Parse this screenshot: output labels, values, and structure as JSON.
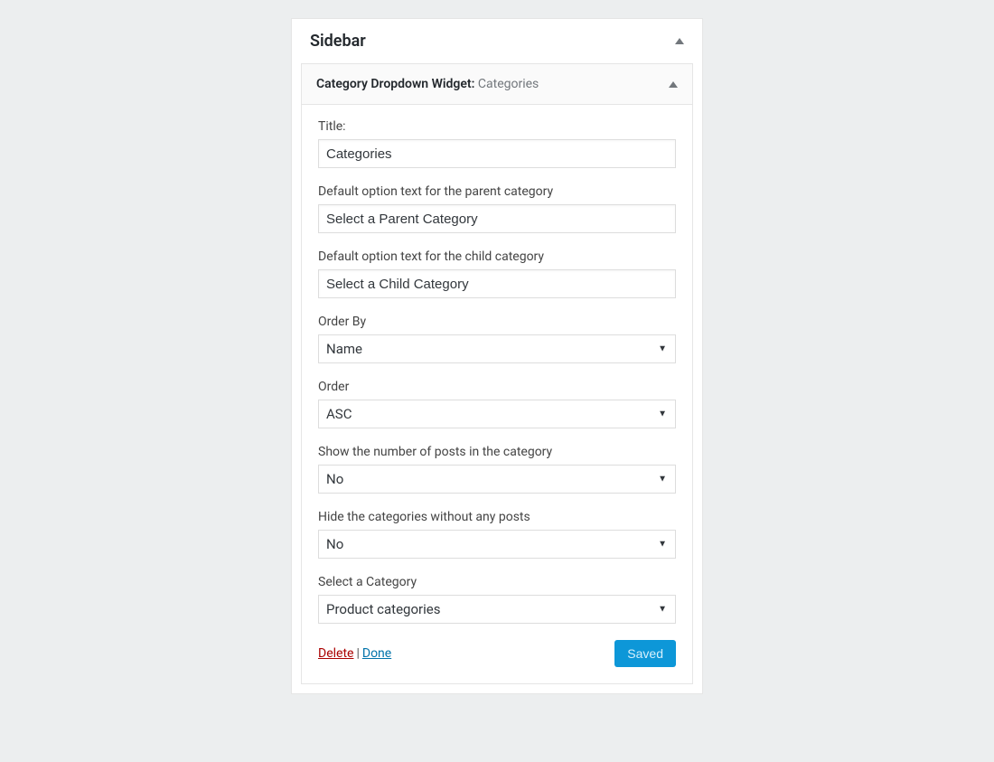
{
  "sidebar": {
    "title": "Sidebar"
  },
  "widget": {
    "name": "Category Dropdown Widget",
    "separator": ": ",
    "instance": "Categories"
  },
  "fields": {
    "title": {
      "label": "Title:",
      "value": "Categories"
    },
    "parent_text": {
      "label": "Default option text for the parent category",
      "value": "Select a Parent Category"
    },
    "child_text": {
      "label": "Default option text for the child category",
      "value": "Select a Child Category"
    },
    "order_by": {
      "label": "Order By",
      "value": "Name"
    },
    "order": {
      "label": "Order",
      "value": "ASC"
    },
    "show_count": {
      "label": "Show the number of posts in the category",
      "value": "No"
    },
    "hide_empty": {
      "label": "Hide the categories without any posts",
      "value": "No"
    },
    "select_category": {
      "label": "Select a Category",
      "value": "Product categories"
    }
  },
  "actions": {
    "delete": "Delete",
    "done": "Done",
    "saved": "Saved"
  }
}
